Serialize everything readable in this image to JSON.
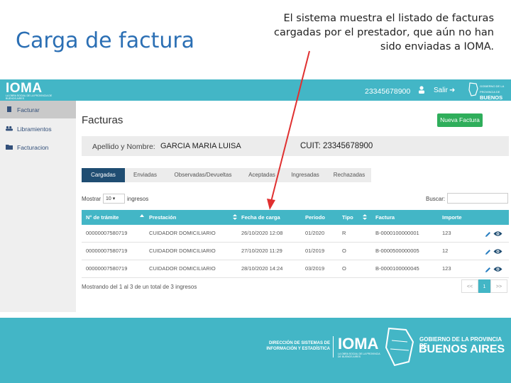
{
  "slide": {
    "title": "Carga de factura",
    "caption": "El sistema muestra el listado de facturas cargadas por el prestador, que aún no han sido enviadas a IOMA."
  },
  "topbar": {
    "logo": "IOMA",
    "logo_sub": "LA OBRA SOCIAL DE LA PROVINCIA DE BUENOS AIRES",
    "user": "23345678900",
    "salir": "Salir",
    "gba_line1": "GOBIERNO DE LA PROVINCIA DE",
    "gba_line2": "BUENOS AIRES"
  },
  "sidebar": {
    "items": [
      {
        "label": "Facturar",
        "icon": "document-icon"
      },
      {
        "label": "Libramientos",
        "icon": "people-icon"
      },
      {
        "label": "Facturacion",
        "icon": "folder-icon"
      }
    ]
  },
  "main": {
    "heading": "Facturas",
    "new_button": "Nueva Factura",
    "client_label": "Apellido y Nombre:",
    "client_name": "GARCIA MARIA LUISA",
    "cuit": "CUIT: 23345678900",
    "tabs": [
      "Cargadas",
      "Enviadas",
      "Observadas/Devueltas",
      "Aceptadas",
      "Ingresadas",
      "Rechazadas"
    ],
    "active_tab": "Cargadas",
    "mostrar_label": "Mostrar",
    "mostrar_value": "10",
    "ingresos_label": "ingresos",
    "buscar_label": "Buscar:",
    "buscar_value": ""
  },
  "table": {
    "headers": [
      "N° de trámite",
      "Prestación",
      "Fecha de carga",
      "Periodo",
      "Tipo",
      "Factura",
      "Importe"
    ],
    "rows": [
      [
        "00000007580719",
        "CUIDADOR DOMICILIARIO",
        "26/10/2020 12:08",
        "01/2020",
        "R",
        "B-0000100000001",
        "123"
      ],
      [
        "00000007580719",
        "CUIDADOR DOMICILIARIO",
        "27/10/2020 11:29",
        "01/2019",
        "O",
        "B-0000500000005",
        "12"
      ],
      [
        "00000007580719",
        "CUIDADOR DOMICILIARIO",
        "28/10/2020 14:24",
        "03/2019",
        "O",
        "B-0000100000045",
        "123"
      ]
    ],
    "info": "Mostrando del 1 al 3 de un total de 3 ingresos",
    "pager": {
      "prev": "<<",
      "page": "1",
      "next": ">>"
    }
  },
  "footer": {
    "dir": "DIRECCIÓN DE SISTEMAS DE INFORMACIÓN Y ESTADÍSTICA",
    "ioma": "IOMA",
    "ioma_sub": "LA OBRA SOCIAL DE LA PROVINCIA DE BUENOS AIRES",
    "gob": "GOBIERNO DE LA PROVINCIA DE",
    "ba": "BUENOS AIRES"
  },
  "colors": {
    "accent": "#43b6c6",
    "active_tab": "#1f4d72",
    "new_button": "#2fae5b",
    "annotation_arrow": "#e03030"
  }
}
